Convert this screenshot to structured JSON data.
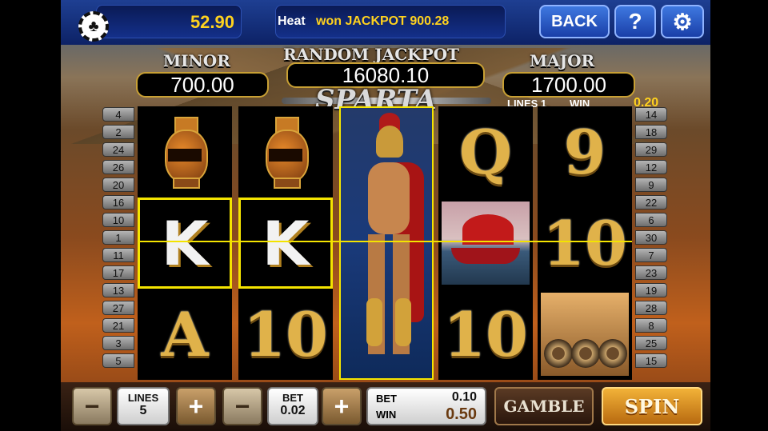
{
  "topbar": {
    "balance": "52.90",
    "ticker_name": "Heat",
    "ticker_message": "won JACKPOT 900.28",
    "back_label": "BACK",
    "help_label": "?",
    "settings_icon": "gear-icon",
    "chip_icon": "club-chip-icon"
  },
  "jackpots": {
    "minor_label": "MINOR",
    "minor_value": "700.00",
    "random_label": "RANDOM JACKPOT",
    "random_value": "16080.10",
    "major_label": "MAJOR",
    "major_value": "1700.00"
  },
  "logo": "SPARTA",
  "win_info": {
    "lines_label": "LINES 1",
    "win_label": "WIN",
    "win_value": "0.20"
  },
  "left_line_numbers": [
    "4",
    "2",
    "24",
    "26",
    "20",
    "16",
    "10",
    "1",
    "11",
    "17",
    "13",
    "27",
    "21",
    "3",
    "5"
  ],
  "right_line_numbers": [
    "14",
    "18",
    "29",
    "12",
    "9",
    "22",
    "6",
    "30",
    "7",
    "23",
    "19",
    "28",
    "8",
    "25",
    "15"
  ],
  "reels": [
    [
      "amphora",
      "K",
      "A"
    ],
    [
      "amphora",
      "K",
      "10"
    ],
    [
      "warrior"
    ],
    [
      "Q",
      "ship",
      "10"
    ],
    [
      "9",
      "10",
      "shields"
    ]
  ],
  "winning_symbols": [
    "reel1-row2",
    "reel2-row2",
    "reel3"
  ],
  "bottombar": {
    "minus_label": "−",
    "plus_label": "+",
    "lines_label": "LINES",
    "lines_value": "5",
    "bet_label": "BET",
    "bet_value": "0.02",
    "total_bet_label": "BET",
    "total_bet_value": "0.10",
    "win_label": "WIN",
    "win_value": "0.50",
    "gamble_label": "GAMBLE",
    "spin_label": "SPIN"
  },
  "colors": {
    "gold": "#e0b24a",
    "payline": "#f4e400",
    "topbar": "#1e3f92",
    "spin": "#f2b238"
  }
}
